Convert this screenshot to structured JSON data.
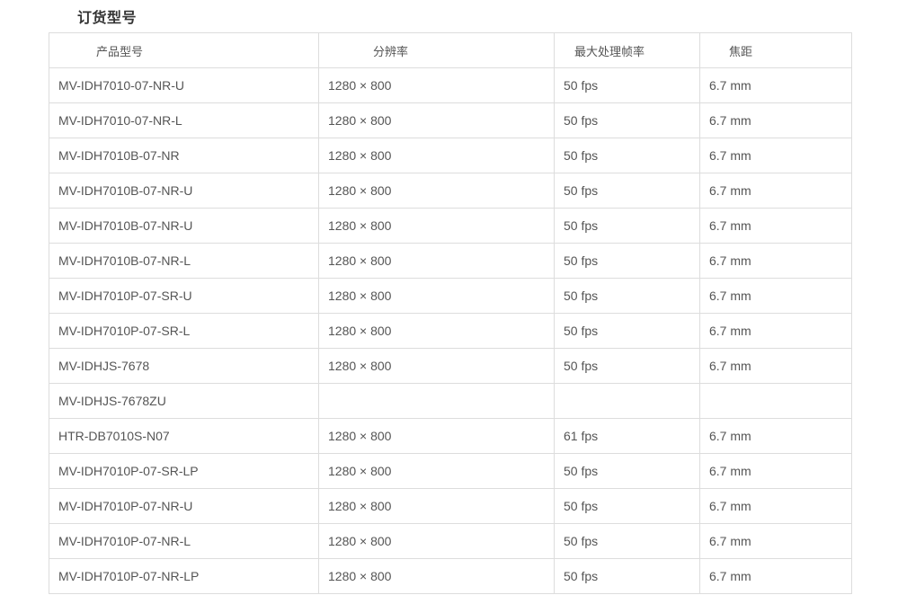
{
  "section": {
    "title": "订货型号"
  },
  "table": {
    "headers": [
      "产品型号",
      "分辨率",
      "最大处理帧率",
      "焦距"
    ],
    "rows": [
      [
        "MV-IDH7010-07-NR-U",
        "1280 × 800",
        "50 fps",
        "6.7 mm"
      ],
      [
        "MV-IDH7010-07-NR-L",
        "1280 × 800",
        "50 fps",
        "6.7 mm"
      ],
      [
        "MV-IDH7010B-07-NR",
        "1280 × 800",
        "50 fps",
        "6.7 mm"
      ],
      [
        "MV-IDH7010B-07-NR-U",
        "1280 × 800",
        "50 fps",
        "6.7 mm"
      ],
      [
        "MV-IDH7010B-07-NR-U",
        "1280 × 800",
        "50 fps",
        "6.7 mm"
      ],
      [
        "MV-IDH7010B-07-NR-L",
        "1280 × 800",
        "50 fps",
        "6.7 mm"
      ],
      [
        "MV-IDH7010P-07-SR-U",
        "1280 × 800",
        "50 fps",
        "6.7 mm"
      ],
      [
        "MV-IDH7010P-07-SR-L",
        "1280 × 800",
        "50 fps",
        "6.7 mm"
      ],
      [
        "MV-IDHJS-7678",
        "1280 × 800",
        "50 fps",
        "6.7 mm"
      ],
      [
        "MV-IDHJS-7678ZU",
        "",
        "",
        ""
      ],
      [
        "HTR-DB7010S-N07",
        "1280 × 800",
        "61 fps",
        "6.7 mm"
      ],
      [
        "MV-IDH7010P-07-SR-LP",
        "1280 × 800",
        "50 fps",
        "6.7 mm"
      ],
      [
        "MV-IDH7010P-07-NR-U",
        "1280 × 800",
        "50 fps",
        "6.7 mm"
      ],
      [
        "MV-IDH7010P-07-NR-L",
        "1280 × 800",
        "50 fps",
        "6.7 mm"
      ],
      [
        "MV-IDH7010P-07-NR-LP",
        "1280 × 800",
        "50 fps",
        "6.7 mm"
      ]
    ]
  }
}
